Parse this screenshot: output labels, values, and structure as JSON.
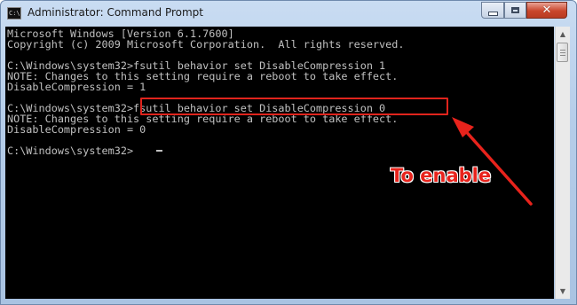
{
  "window": {
    "title": "Administrator: Command Prompt",
    "icon_label": "C:\\",
    "icons": {
      "app": "cmd-app-icon",
      "minimize": "minimize-icon",
      "maximize": "maximize-icon",
      "close": "close-icon"
    }
  },
  "console": {
    "lines": [
      "Microsoft Windows [Version 6.1.7600]",
      "Copyright (c) 2009 Microsoft Corporation.  All rights reserved.",
      "",
      "C:\\Windows\\system32>fsutil behavior set DisableCompression 1",
      "NOTE: Changes to this setting require a reboot to take effect.",
      "DisableCompression = 1",
      "",
      "C:\\Windows\\system32>fsutil behavior set DisableCompression 0",
      "NOTE: Changes to this setting require a reboot to take effect.",
      "DisableCompression = 0",
      "",
      "C:\\Windows\\system32>"
    ],
    "text_color": "#c0c0c0",
    "background": "#000000"
  },
  "annotation": {
    "label": "To enable",
    "color": "#e8231c"
  },
  "scrollbar": {
    "up_glyph": "▲",
    "down_glyph": "▼"
  }
}
